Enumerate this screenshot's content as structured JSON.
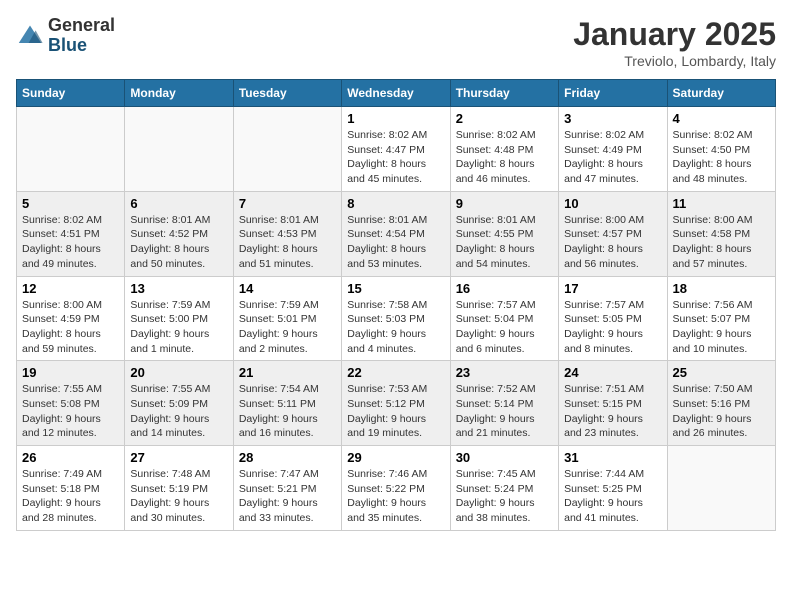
{
  "header": {
    "logo_general": "General",
    "logo_blue": "Blue",
    "title": "January 2025",
    "subtitle": "Treviolo, Lombardy, Italy"
  },
  "weekdays": [
    "Sunday",
    "Monday",
    "Tuesday",
    "Wednesday",
    "Thursday",
    "Friday",
    "Saturday"
  ],
  "weeks": [
    [
      {
        "day": "",
        "sunrise": "",
        "sunset": "",
        "daylight": ""
      },
      {
        "day": "",
        "sunrise": "",
        "sunset": "",
        "daylight": ""
      },
      {
        "day": "",
        "sunrise": "",
        "sunset": "",
        "daylight": ""
      },
      {
        "day": "1",
        "sunrise": "Sunrise: 8:02 AM",
        "sunset": "Sunset: 4:47 PM",
        "daylight": "Daylight: 8 hours and 45 minutes."
      },
      {
        "day": "2",
        "sunrise": "Sunrise: 8:02 AM",
        "sunset": "Sunset: 4:48 PM",
        "daylight": "Daylight: 8 hours and 46 minutes."
      },
      {
        "day": "3",
        "sunrise": "Sunrise: 8:02 AM",
        "sunset": "Sunset: 4:49 PM",
        "daylight": "Daylight: 8 hours and 47 minutes."
      },
      {
        "day": "4",
        "sunrise": "Sunrise: 8:02 AM",
        "sunset": "Sunset: 4:50 PM",
        "daylight": "Daylight: 8 hours and 48 minutes."
      }
    ],
    [
      {
        "day": "5",
        "sunrise": "Sunrise: 8:02 AM",
        "sunset": "Sunset: 4:51 PM",
        "daylight": "Daylight: 8 hours and 49 minutes."
      },
      {
        "day": "6",
        "sunrise": "Sunrise: 8:01 AM",
        "sunset": "Sunset: 4:52 PM",
        "daylight": "Daylight: 8 hours and 50 minutes."
      },
      {
        "day": "7",
        "sunrise": "Sunrise: 8:01 AM",
        "sunset": "Sunset: 4:53 PM",
        "daylight": "Daylight: 8 hours and 51 minutes."
      },
      {
        "day": "8",
        "sunrise": "Sunrise: 8:01 AM",
        "sunset": "Sunset: 4:54 PM",
        "daylight": "Daylight: 8 hours and 53 minutes."
      },
      {
        "day": "9",
        "sunrise": "Sunrise: 8:01 AM",
        "sunset": "Sunset: 4:55 PM",
        "daylight": "Daylight: 8 hours and 54 minutes."
      },
      {
        "day": "10",
        "sunrise": "Sunrise: 8:00 AM",
        "sunset": "Sunset: 4:57 PM",
        "daylight": "Daylight: 8 hours and 56 minutes."
      },
      {
        "day": "11",
        "sunrise": "Sunrise: 8:00 AM",
        "sunset": "Sunset: 4:58 PM",
        "daylight": "Daylight: 8 hours and 57 minutes."
      }
    ],
    [
      {
        "day": "12",
        "sunrise": "Sunrise: 8:00 AM",
        "sunset": "Sunset: 4:59 PM",
        "daylight": "Daylight: 8 hours and 59 minutes."
      },
      {
        "day": "13",
        "sunrise": "Sunrise: 7:59 AM",
        "sunset": "Sunset: 5:00 PM",
        "daylight": "Daylight: 9 hours and 1 minute."
      },
      {
        "day": "14",
        "sunrise": "Sunrise: 7:59 AM",
        "sunset": "Sunset: 5:01 PM",
        "daylight": "Daylight: 9 hours and 2 minutes."
      },
      {
        "day": "15",
        "sunrise": "Sunrise: 7:58 AM",
        "sunset": "Sunset: 5:03 PM",
        "daylight": "Daylight: 9 hours and 4 minutes."
      },
      {
        "day": "16",
        "sunrise": "Sunrise: 7:57 AM",
        "sunset": "Sunset: 5:04 PM",
        "daylight": "Daylight: 9 hours and 6 minutes."
      },
      {
        "day": "17",
        "sunrise": "Sunrise: 7:57 AM",
        "sunset": "Sunset: 5:05 PM",
        "daylight": "Daylight: 9 hours and 8 minutes."
      },
      {
        "day": "18",
        "sunrise": "Sunrise: 7:56 AM",
        "sunset": "Sunset: 5:07 PM",
        "daylight": "Daylight: 9 hours and 10 minutes."
      }
    ],
    [
      {
        "day": "19",
        "sunrise": "Sunrise: 7:55 AM",
        "sunset": "Sunset: 5:08 PM",
        "daylight": "Daylight: 9 hours and 12 minutes."
      },
      {
        "day": "20",
        "sunrise": "Sunrise: 7:55 AM",
        "sunset": "Sunset: 5:09 PM",
        "daylight": "Daylight: 9 hours and 14 minutes."
      },
      {
        "day": "21",
        "sunrise": "Sunrise: 7:54 AM",
        "sunset": "Sunset: 5:11 PM",
        "daylight": "Daylight: 9 hours and 16 minutes."
      },
      {
        "day": "22",
        "sunrise": "Sunrise: 7:53 AM",
        "sunset": "Sunset: 5:12 PM",
        "daylight": "Daylight: 9 hours and 19 minutes."
      },
      {
        "day": "23",
        "sunrise": "Sunrise: 7:52 AM",
        "sunset": "Sunset: 5:14 PM",
        "daylight": "Daylight: 9 hours and 21 minutes."
      },
      {
        "day": "24",
        "sunrise": "Sunrise: 7:51 AM",
        "sunset": "Sunset: 5:15 PM",
        "daylight": "Daylight: 9 hours and 23 minutes."
      },
      {
        "day": "25",
        "sunrise": "Sunrise: 7:50 AM",
        "sunset": "Sunset: 5:16 PM",
        "daylight": "Daylight: 9 hours and 26 minutes."
      }
    ],
    [
      {
        "day": "26",
        "sunrise": "Sunrise: 7:49 AM",
        "sunset": "Sunset: 5:18 PM",
        "daylight": "Daylight: 9 hours and 28 minutes."
      },
      {
        "day": "27",
        "sunrise": "Sunrise: 7:48 AM",
        "sunset": "Sunset: 5:19 PM",
        "daylight": "Daylight: 9 hours and 30 minutes."
      },
      {
        "day": "28",
        "sunrise": "Sunrise: 7:47 AM",
        "sunset": "Sunset: 5:21 PM",
        "daylight": "Daylight: 9 hours and 33 minutes."
      },
      {
        "day": "29",
        "sunrise": "Sunrise: 7:46 AM",
        "sunset": "Sunset: 5:22 PM",
        "daylight": "Daylight: 9 hours and 35 minutes."
      },
      {
        "day": "30",
        "sunrise": "Sunrise: 7:45 AM",
        "sunset": "Sunset: 5:24 PM",
        "daylight": "Daylight: 9 hours and 38 minutes."
      },
      {
        "day": "31",
        "sunrise": "Sunrise: 7:44 AM",
        "sunset": "Sunset: 5:25 PM",
        "daylight": "Daylight: 9 hours and 41 minutes."
      },
      {
        "day": "",
        "sunrise": "",
        "sunset": "",
        "daylight": ""
      }
    ]
  ]
}
